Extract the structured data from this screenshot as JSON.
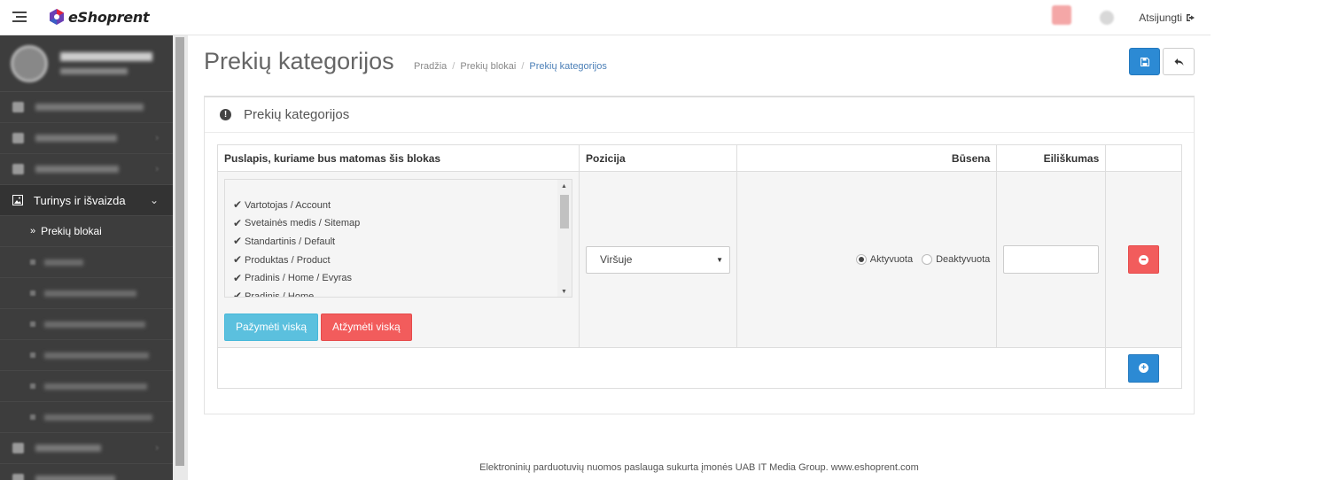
{
  "topbar": {
    "logo_text": "eShoprent",
    "logout_label": "Atsijungti",
    "logout_icon": "sign-out-icon"
  },
  "sidebar": {
    "active_section": "Turinys ir išvaizda",
    "current_item": "Prekių blokai"
  },
  "page": {
    "title": "Prekių kategorijos",
    "breadcrumb": [
      "Pradžia",
      "Prekių blokai",
      "Prekių kategorijos"
    ]
  },
  "panel": {
    "title": "Prekių kategorijos",
    "columns": [
      "Puslapis, kuriame bus matomas šis blokas",
      "Pozicija",
      "Būsena",
      "Eiliškumas",
      ""
    ],
    "pages": [
      {
        "label": "Vartotojas / Account",
        "checked": true
      },
      {
        "label": "Svetainės medis / Sitemap",
        "checked": true
      },
      {
        "label": "Standartinis / Default",
        "checked": true
      },
      {
        "label": "Produktas / Product",
        "checked": true
      },
      {
        "label": "Pradinis / Home / Evyras",
        "checked": true
      },
      {
        "label": "Pradinis / Home",
        "checked": true
      }
    ],
    "select_all_label": "Pažymėti viską",
    "deselect_all_label": "Atžymėti viską",
    "position_value": "Viršuje",
    "status_options": [
      "Aktyvuota",
      "Deaktyvuota"
    ],
    "status_selected": "Aktyvuota",
    "order_value": ""
  },
  "footer": {
    "text": "Elektroninių parduotuvių nuomos paslauga sukurta įmonės UAB IT Media Group. www.eshoprent.com"
  },
  "colors": {
    "primary": "#2c8ad4",
    "danger": "#f25c5c",
    "info": "#5bc0de",
    "sidebar_bg": "#3d3d3d"
  }
}
